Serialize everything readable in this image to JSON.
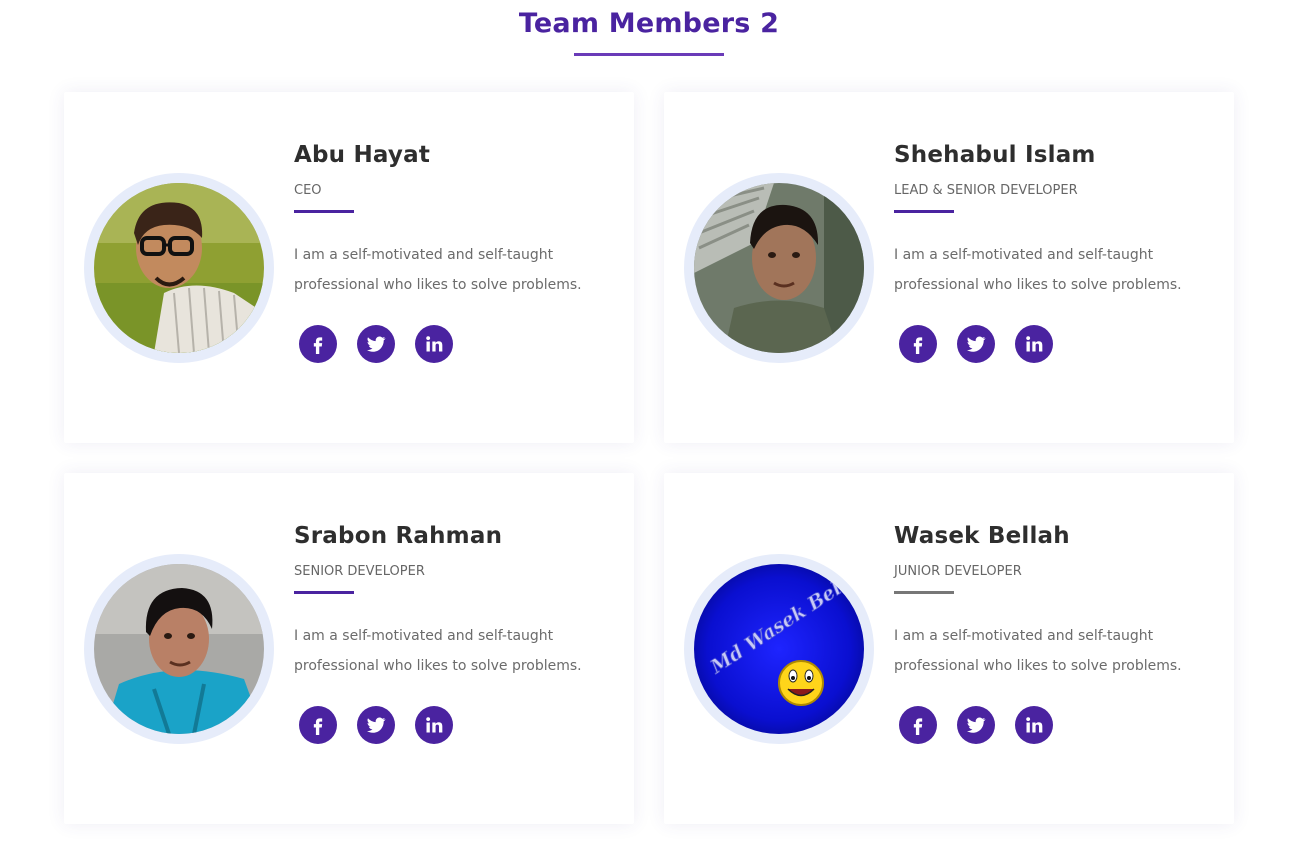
{
  "section": {
    "title": "Team Members 2"
  },
  "colors": {
    "accent": "#4a23a0",
    "underline": "#6a3bb8",
    "ring": "#e6ecfa"
  },
  "social_icons": [
    "facebook-icon",
    "twitter-icon",
    "linkedin-icon"
  ],
  "members": [
    {
      "name": "Abu Hayat",
      "role": "CEO",
      "bio": "I am a self-motivated and self-taught professional who likes to solve problems.",
      "divider_color": "#4a23a0"
    },
    {
      "name": "Shehabul Islam",
      "role": "LEAD & SENIOR DEVELOPER",
      "bio": "I am a self-motivated and self-taught professional who likes to solve problems.",
      "divider_color": "#4a23a0"
    },
    {
      "name": "Srabon Rahman",
      "role": "SENIOR DEVELOPER",
      "bio": "I am a self-motivated and self-taught professional who likes to solve problems.",
      "divider_color": "#4a23a0"
    },
    {
      "name": "Wasek Bellah",
      "role": "JUNIOR DEVELOPER",
      "bio": "I am a self-motivated and self-taught professional who likes to solve problems.",
      "divider_color": "#777777",
      "avatar_text": "Md Wasek Bellah"
    }
  ]
}
